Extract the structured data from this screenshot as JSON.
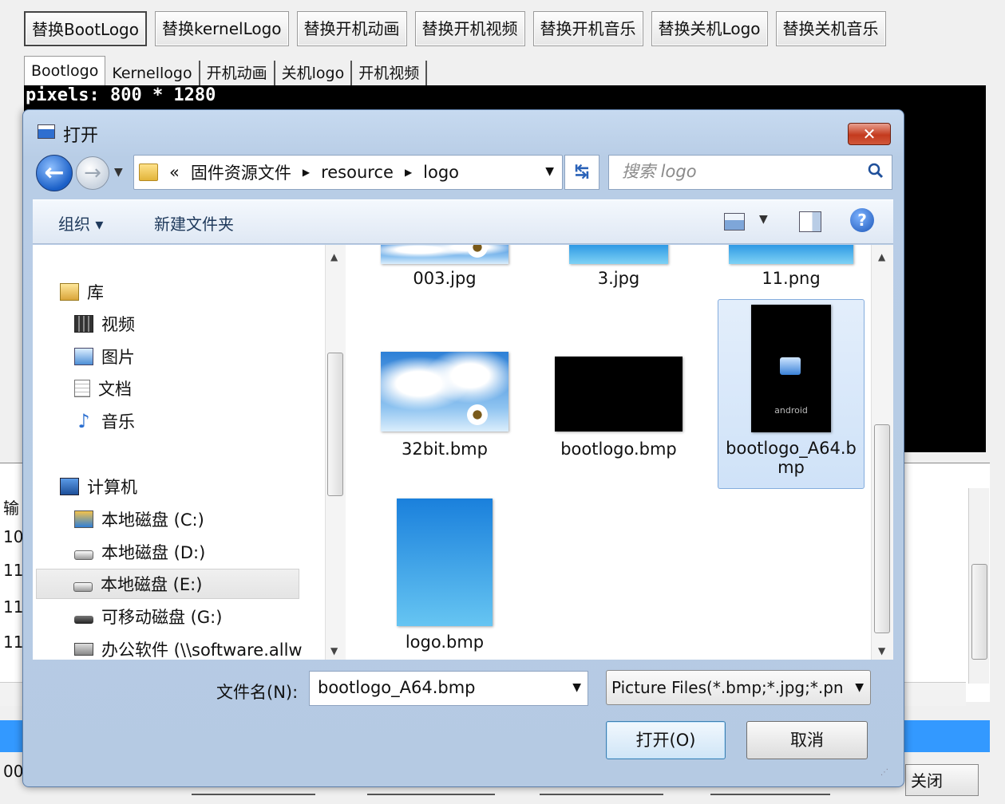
{
  "app": {
    "toolbar": [
      "替换BootLogo",
      "替换kernelLogo",
      "替换开机动画",
      "替换开机视频",
      "替换开机音乐",
      "替换关机Logo",
      "替换关机音乐"
    ],
    "tabs": [
      "Bootlogo",
      "Kernellogo",
      "开机动画",
      "关机logo",
      "开机视频"
    ],
    "pixels_label": "pixels: 800 * 1280",
    "log_fragments": [
      "输",
      "10",
      "11",
      "11",
      "11"
    ],
    "status_fragment": "00",
    "close_label": "关闭"
  },
  "dialog": {
    "title": "打开",
    "close_glyph": "✕",
    "address": {
      "prefix": "«",
      "segments": [
        "固件资源文件",
        "resource",
        "logo"
      ]
    },
    "search_placeholder": "搜索 logo",
    "commands": {
      "organize": "组织 ▾",
      "new_folder": "新建文件夹"
    },
    "help_glyph": "?",
    "nav": {
      "libraries": "库",
      "library_items": [
        "视频",
        "图片",
        "文档",
        "音乐"
      ],
      "computer": "计算机",
      "drives": [
        "本地磁盘 (C:)",
        "本地磁盘 (D:)",
        "本地磁盘 (E:)",
        "可移动磁盘 (G:)",
        "办公软件 (\\\\software.allw"
      ]
    },
    "files": [
      {
        "name": "003.jpg"
      },
      {
        "name": "3.jpg"
      },
      {
        "name": "11.png"
      },
      {
        "name": "32bit.bmp"
      },
      {
        "name": "bootlogo.bmp"
      },
      {
        "name": "bootlogo_A64.bmp",
        "name_line1": "bootlogo_A64.b",
        "name_line2": "mp",
        "selected": true
      },
      {
        "name": "logo.bmp"
      }
    ],
    "thumb_text": {
      "android": "android"
    },
    "filename_label": "文件名(N):",
    "filename_value": "bootlogo_A64.bmp",
    "filter_value": "Picture Files(*.bmp;*.jpg;*.pn",
    "open_button": "打开(O)",
    "cancel_button": "取消"
  }
}
